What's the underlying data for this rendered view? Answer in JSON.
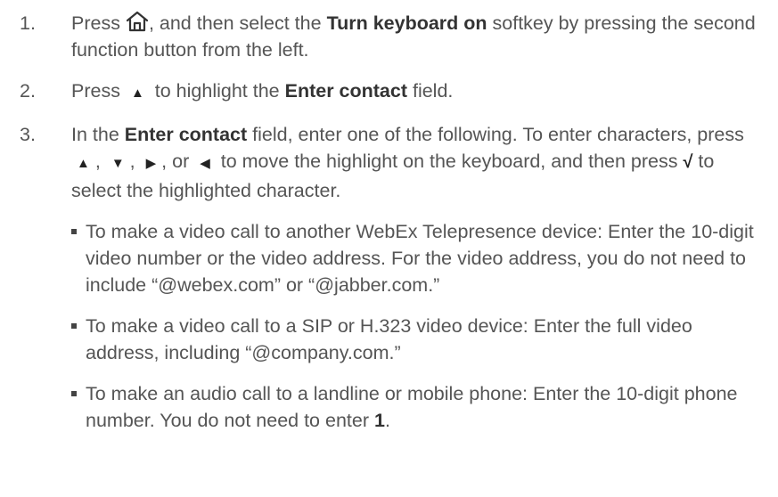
{
  "steps": [
    {
      "number": "1.",
      "parts": {
        "a": "Press ",
        "icon": "home-icon",
        "b": ", and then select the ",
        "bold": "Turn keyboard on",
        "c": " softkey by pressing the second function button from the left."
      }
    },
    {
      "number": "2.",
      "parts": {
        "a": "Press ",
        "icon": "up-arrow-icon",
        "b": " to highlight the ",
        "bold": "Enter contact",
        "c": " field."
      }
    },
    {
      "number": "3.",
      "parts": {
        "a": "In the ",
        "bold": "Enter contact",
        "b": " field, enter one of the following. To enter characters, press ",
        "up": "▲",
        "sep1": ", ",
        "down": "▼",
        "sep2": ", ",
        "right": "▶",
        "sep3": ", or ",
        "left": "◀",
        "c": " to move the highlight on the keyboard, and then press ",
        "check": "√",
        "d": " to select the highlighted character."
      },
      "bullets": [
        {
          "text": "To make a video call to another WebEx Telepresence device: Enter the 10-digit video number or the video address. For the video address, you do not need to include “@webex.com” or “@jabber.com.”"
        },
        {
          "text": "To make a video call to a SIP or H.323 video device: Enter the full video address, including “@company.com.”"
        },
        {
          "text_before": "To make an audio call to a landline or mobile phone: Enter the 10-digit phone number. You do not need to enter ",
          "bold": "1",
          "text_after": "."
        }
      ]
    }
  ],
  "glyphs": {
    "up_arrow": "▲"
  }
}
